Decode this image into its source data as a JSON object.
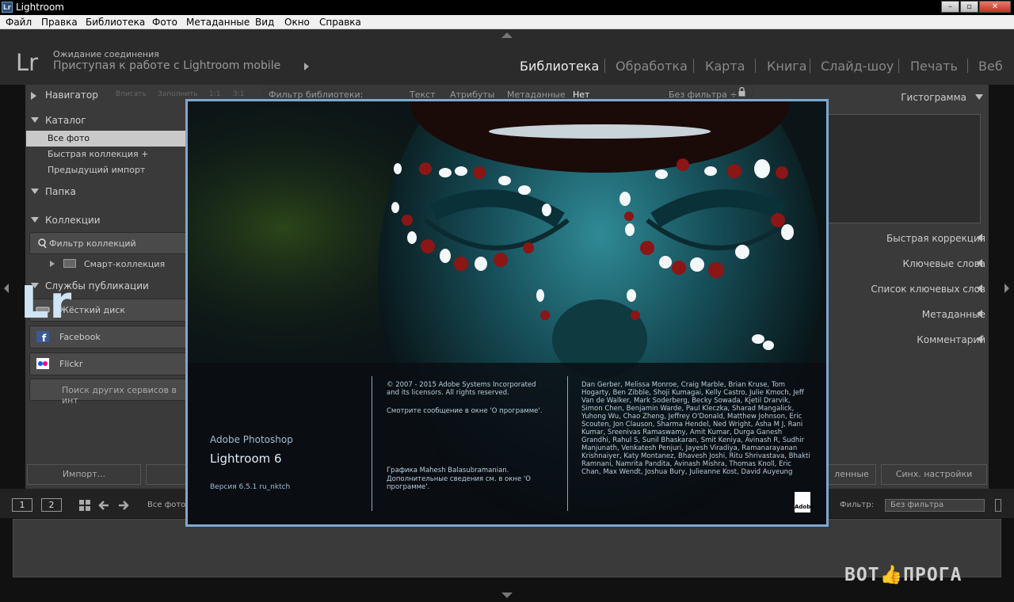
{
  "window": {
    "title": "Lightroom",
    "icon_text": "Lr"
  },
  "menu": [
    "Файл",
    "Правка",
    "Библиотека",
    "Фото",
    "Метаданные",
    "Вид",
    "Окно",
    "Справка"
  ],
  "identity": {
    "logo": "Lr",
    "status_line1": "Ожидание соединения",
    "status_line2": "Приступая к работе с Lightroom mobile"
  },
  "modules": [
    "Библиотека",
    "Обработка",
    "Карта",
    "Книга",
    "Слайд-шоу",
    "Печать",
    "Веб"
  ],
  "left_panel": {
    "navigator": {
      "label": "Навигатор",
      "options": [
        "Вписать",
        "Заполнить",
        "1:1",
        "3:1"
      ]
    },
    "catalog": {
      "label": "Каталог",
      "items": [
        "Все фото",
        "Быстрая коллекция  +",
        "Предыдущий импорт"
      ]
    },
    "folders": {
      "label": "Папка"
    },
    "collections": {
      "label": "Коллекции",
      "filter": "Фильтр коллекций",
      "smart": "Смарт-коллекция"
    },
    "publish": {
      "label": "Службы публикации",
      "services": [
        "Жёсткий диск",
        "Facebook",
        "Flickr"
      ],
      "find_more": "Поиск других сервисов в инт"
    },
    "import_button": "Импорт..."
  },
  "filter_bar": {
    "label": "Фильтр библиотеки:",
    "options": [
      "Текст",
      "Атрибуты",
      "Метаданные",
      "Нет"
    ],
    "preset": "Без фильтра ÷"
  },
  "right_panel": {
    "histogram": "Гистограмма",
    "sections": [
      "Быстрая коррекция",
      "Ключевые слова",
      "Список ключевых слов",
      "Метаданные",
      "Комментарий"
    ],
    "sync_partial": "ленные",
    "sync_button": "Синх. настройки"
  },
  "filmstrip": {
    "view1": "1",
    "view2": "2",
    "source": "Все фото",
    "filter_label": "Фильтр:",
    "filter_value": "Без фильтра"
  },
  "splash": {
    "logo": "Lr",
    "brand": "Adobe Photoshop",
    "product": "Lightroom 6",
    "version": "Версия 6.5.1 ru_nktch",
    "copyright": "© 2007 - 2015 Adobe Systems Incorporated and its licensors. All rights reserved.",
    "about_note": "Смотрите сообщение в окне 'О программе'.",
    "art_credit": "Графика Mahesh Balasubramanian.",
    "more_info": "Дополнительные сведения см. в окне 'О программе'.",
    "credits": "Dan Gerber, Melissa Monroe, Craig Marble, Brian Kruse, Tom Hogarty, Ben Zibble, Shoji Kumagai, Kelly Castro, Julie Kmoch, Jeff Van de Walker, Mark Soderberg, Becky Sowada, Kjetil Drarvik, Simon Chen, Benjamin Warde, Paul Kleczka, Sharad Mangalick, Yuhong Wu, Chao Zheng, Jeffrey O'Donald, Matthew Johnson, Eric Scouten, Jon Clauson, Sharma Hendel, Ned Wright, Asha M J, Rani Kumar, Sreenivas Ramaswamy, Amit Kumar, Durga Ganesh Grandhi, Rahul S, Sunil Bhaskaran, Smit Keniya, Avinash R, Sudhir Manjunath, Venkatesh Penjuri, Jayesh Viradiya, Ramanarayanan Krishnaiyer, Katy Montanez, Bhavesh Joshi, Ritu Shrivastava, Bhakti Ramnani, Namrita Pandita, Avinash Mishra, Thomas Knoll, Eric Chan, Max Wendt, Joshua Bury, Julieanne Kost, David Auyeung",
    "adobe_mark": "Adobe"
  },
  "watermark": "BOT👍ПРОГА"
}
